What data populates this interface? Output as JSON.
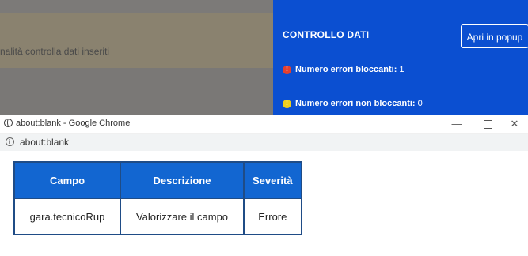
{
  "background_page": {
    "band_text": "nalità controlla dati inseriti"
  },
  "panel": {
    "title": "CONTROLLO DATI",
    "popup_button": "Apri in popup",
    "blocking_label": "Numero errori bloccanti:",
    "blocking_count": "1",
    "nonblocking_label": "Numero errori non bloccanti:",
    "nonblocking_count": "0",
    "colors": {
      "panel": "#0b4fd1",
      "error_dot": "#e3402f",
      "warning_dot": "#f0cf1c"
    }
  },
  "popup_window": {
    "title": "about:blank - Google Chrome",
    "address": "about:blank",
    "controls": {
      "minimize": "—",
      "close": "✕"
    }
  },
  "table": {
    "headers": [
      "Campo",
      "Descrizione",
      "Severità"
    ],
    "rows": [
      [
        "gara.tecnicoRup",
        "Valorizzare il campo",
        "Errore"
      ]
    ],
    "colors": {
      "header_bg": "#1266d1",
      "border": "#1f4c86"
    }
  }
}
